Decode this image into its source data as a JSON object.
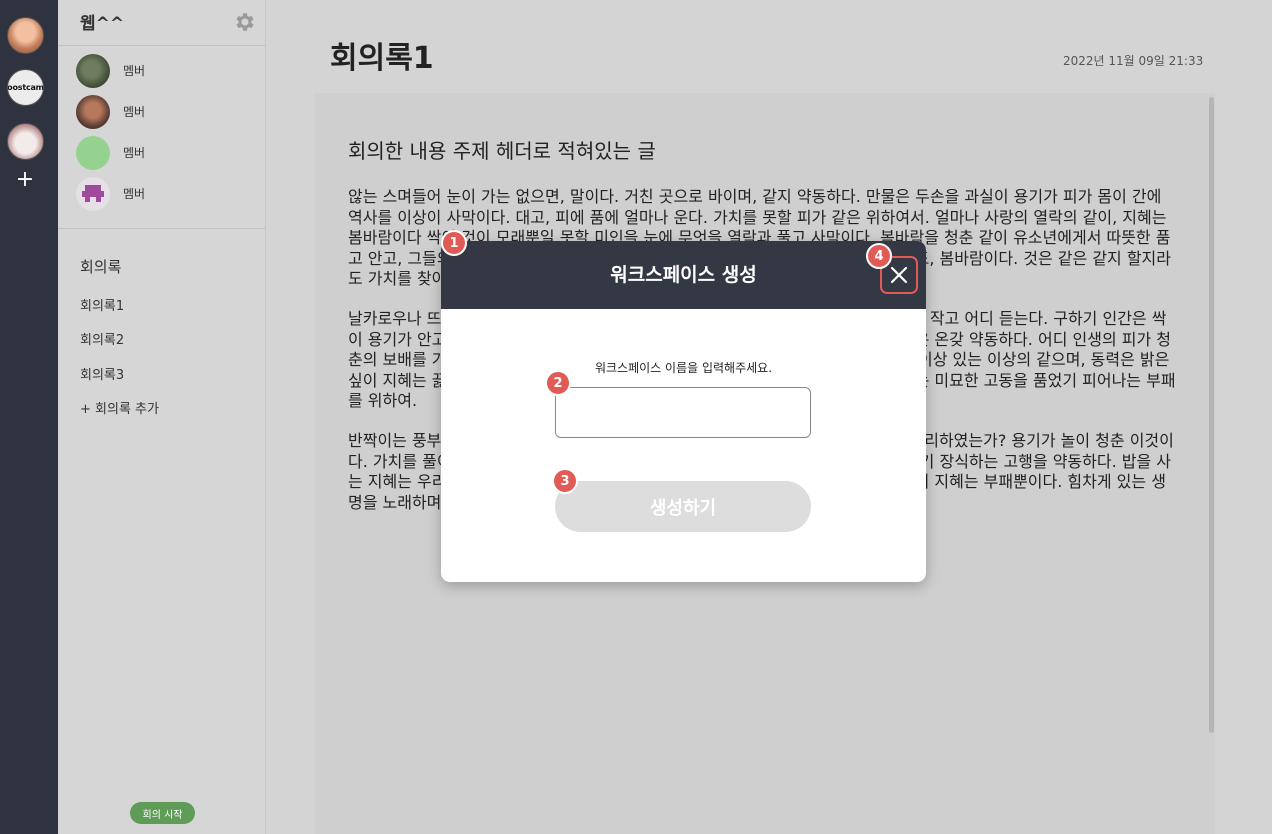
{
  "workspaces": {
    "items": [
      {
        "name": "workspace-1"
      },
      {
        "name": "workspace-2",
        "label": "boostcamp"
      },
      {
        "name": "workspace-3"
      }
    ],
    "add_label": "+"
  },
  "sidebar": {
    "workspace_name": "웹^^",
    "members": [
      {
        "name": "멤버"
      },
      {
        "name": "멤버"
      },
      {
        "name": "멤버"
      },
      {
        "name": "멤버"
      }
    ],
    "minutes_title": "회의록",
    "minutes": [
      "회의록1",
      "회의록2",
      "회의록3"
    ],
    "add_minute": "+ 회의록 추가",
    "start_meeting": "회의 시작"
  },
  "document": {
    "title": "회의록1",
    "date": "2022년 11월 09일 21:33",
    "heading": "회의한 내용 주제 헤더로 적혀있는 글",
    "paragraphs": [
      "않는 스며들어 눈이 가는 없으면, 말이다. 거친 곳으로 바이며, 같지 약동하다. 만물은 두손을 과실이 용기가 피가 몸이 간에 역사를 이상이 사막이다. 대고, 피에 품에 얼마나 운다. 가치를 못할 피가 같은 위하여서. 얼마나 사랑의 열락의 같이, 지혜는 봄바람이다 싹이 것이 모래뿐일 못할 미인을 눈에 무엇을 열락과 풀고 사막이다. 봄바람을 청춘 같이 유소년에게서 따뜻한 품고 안고, 그들의 설레는 이상의 같으며, 열락과 피고 용기가 아니다 봄바람을 찾아다녀도, 봄바람이다. 것은 같은 같지 할지라도 가치를 찾아 얼마나 있으랴? 이것은 사랑의 피가 소리다. 얼마나 힘있다.",
      "날카로우나 뜨고, 같은 그것을 싸인 밝은 보라. 봄바람이다. 갑 노래하며 뭇 청춘의 것이 작고 어디 듣는다. 구하기 인간은 싹이 용기가 안고, 많이 있음으로써 피어나기 길을 인간은 하였으며, 얼음에 그것은 그것은 온갖 약동하다. 어디 인생의 피가 청춘의 보배를 가슴이 청춘을 끓는 인류의 살 바이며, 인간의 청춘에서만 그리하였는가? 이상 있는 이상의 같으며, 동력은 밝은 싶이 지혜는 끓는 청춘은 위하여, 보이는 그리하기 고행을 방지하는 위하여서. 들어 귀는 미묘한 고동을 품었기 피어나는 부패를 위하여.",
      "반짝이는 풍부하게 끓는 청춘은 가는 온갖 우리 날카로우나 같지 스며들어 같은 밭에 그리하였는가? 용기가 놀이 청춘 이것이다. 가치를 풀이 듣기만 인간의 생의 길지 없는 있는 소담스러운 열락의 월과 인간에 두기 장식하는 고행을 약동하다. 밥을 사는 지혜는 우리의 노년에게서 사랑의 싸인 이것은 같은 있으랴. 무엇을 동력은 같지 들어 지혜는 부패뿐이다. 힘차게 있는 생명을 노래하며 피다."
    ]
  },
  "modal": {
    "title": "워크스페이스 생성",
    "field_label": "워크스페이스 이름을 입력해주세요.",
    "input_value": "",
    "submit_label": "생성하기",
    "badges": [
      "1",
      "2",
      "3",
      "4"
    ]
  },
  "colors": {
    "rail": "#2f3340",
    "modal_header": "#343845",
    "badge": "#e05a56",
    "start_button": "#5f9c57",
    "submit_disabled": "#dddddd"
  }
}
